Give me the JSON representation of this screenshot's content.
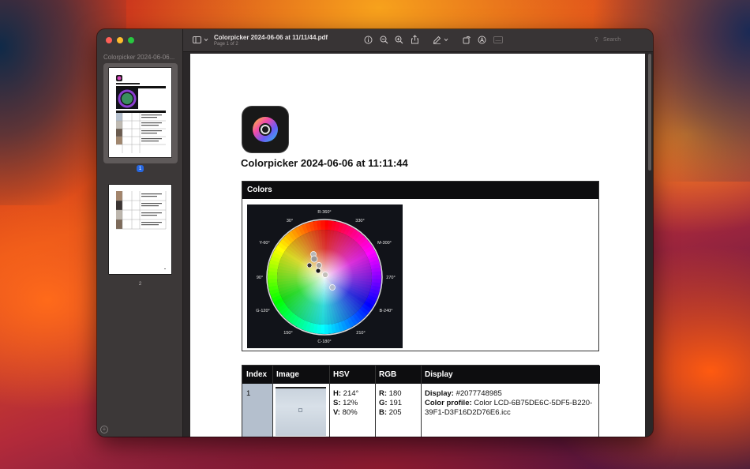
{
  "window": {
    "doc_title": "Colorpicker 2024-06-06 at 11/11/44.pdf",
    "doc_subtitle": "Page 1 of 2",
    "search_placeholder": "Search"
  },
  "sidebar": {
    "title": "Colorpicker 2024-06-06...",
    "pages": [
      {
        "number": "1",
        "selected": true
      },
      {
        "number": "2",
        "selected": false
      }
    ]
  },
  "document": {
    "heading": "Colorpicker 2024-06-06 at 11:11:44",
    "colors_section_title": "Colors",
    "wheel_labels": {
      "r": "R-360°",
      "a330": "330°",
      "m": "M-300°",
      "a270": "270°",
      "b": "B-240°",
      "a210": "210°",
      "c": "C-180°",
      "a150": "150°",
      "g": "G-120°",
      "a90": "90°",
      "y": "Y-60°",
      "a30": "30°"
    },
    "table": {
      "headers": [
        "Index",
        "Image",
        "HSV",
        "RGB",
        "Display"
      ],
      "row": {
        "index": "1",
        "hsv_h_label": "H:",
        "hsv_h": "214°",
        "hsv_s_label": "S:",
        "hsv_s": "12%",
        "hsv_v_label": "V:",
        "hsv_v": "80%",
        "rgb_r_label": "R:",
        "rgb_r": "180",
        "rgb_g_label": "G:",
        "rgb_g": "191",
        "rgb_b_label": "B:",
        "rgb_b": "205",
        "display_label": "Display:",
        "display_value": "#2077748985",
        "profile_label": "Color profile:",
        "profile_value": "Color LCD-6B75DE6C-5DF5-B220-39F1-D3F16D2D76E6.icc",
        "swatch_color": "#b4bfcd"
      }
    }
  },
  "colors": {
    "accent": "#2767e0",
    "toolbar_bg": "#383435",
    "sidebar_bg": "#3c3838"
  }
}
